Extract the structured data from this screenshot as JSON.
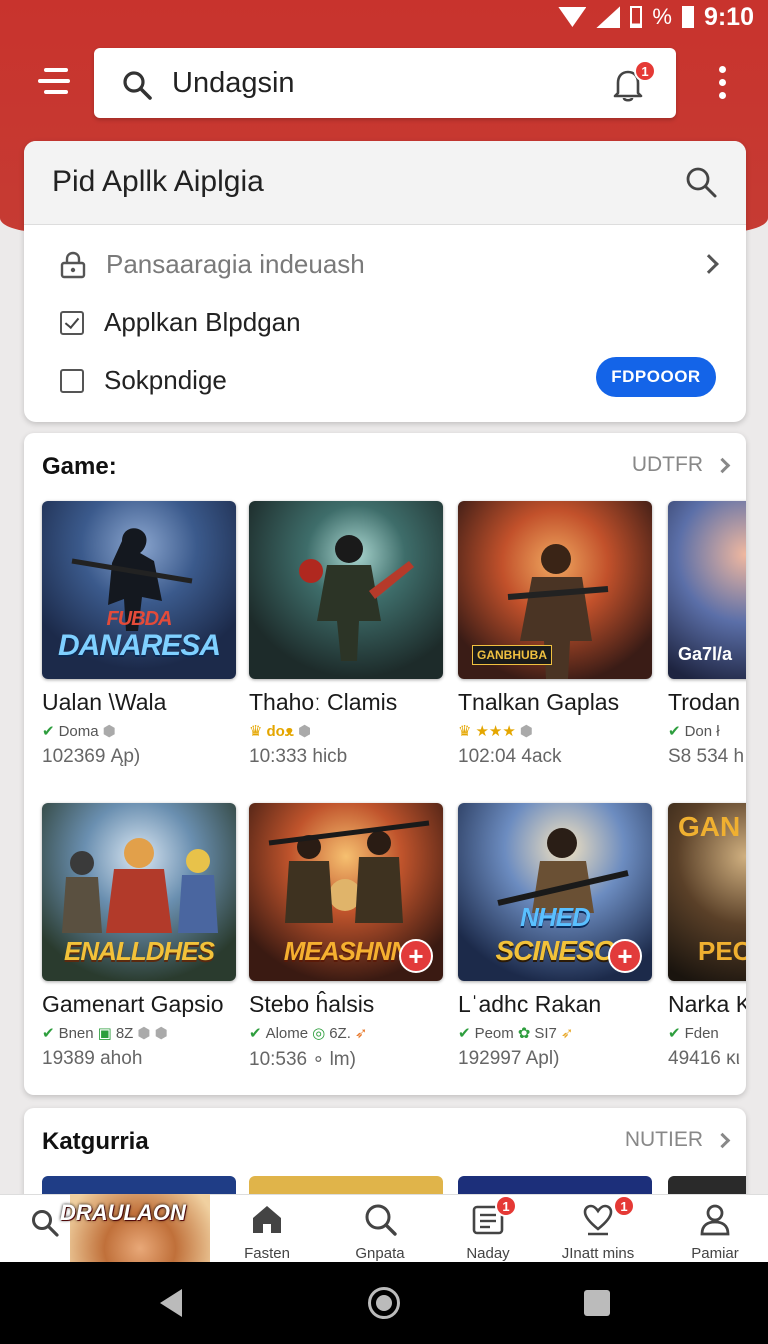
{
  "status_bar": {
    "time": "9:10"
  },
  "search": {
    "query": "Undagsin",
    "notification_count": "1"
  },
  "filter_card": {
    "title": "Pid Apllk Aiplgia",
    "rows": [
      {
        "label": "Pansaaragia indeuash"
      },
      {
        "label": "Applkan Blpdgan",
        "checked": true
      },
      {
        "label": "Sokpndige",
        "checked": false
      }
    ],
    "action_label": "FDPOOOR"
  },
  "games": {
    "title": "Game:",
    "more_label": "UDTFR",
    "tiles": [
      {
        "name": "Ualan \\Wala",
        "meta": "Doma",
        "size": "102369 Ąp)",
        "logo": "DANARESA",
        "logo_top": "FUBDA"
      },
      {
        "name": "Thahoː Clamis",
        "meta": "doᴥ",
        "size": "10:333 hicb"
      },
      {
        "name": "Tnalkan Gaplas",
        "meta": "★★★",
        "size": "102:04 4ack",
        "logo": "GANBHUBA"
      },
      {
        "name": "Trodan",
        "meta": "Don ł",
        "size": "S8 534 h",
        "logo": "Ga7l/a"
      },
      {
        "name": "Gamenart Gapsio",
        "meta": "Bnen",
        "meta2": "8Z",
        "size": "19389 ahoh",
        "logo": "ENALLDHES"
      },
      {
        "name": "Stebo ĥalsis",
        "meta": "Alome",
        "meta2": "6Z.",
        "size": "10:536 ∘ lm)",
        "logo": "MEASHNN"
      },
      {
        "name": "Lˈadhc Rakan",
        "meta": "Peom",
        "meta2": "SI7",
        "size": "192997 Apl)",
        "logo": "SCINESO",
        "logo_top": "NHED"
      },
      {
        "name": "Narka K",
        "meta": "Fden",
        "size": "49416 κι",
        "logo": "PEC",
        "logo_top": "GAN"
      }
    ]
  },
  "categories": {
    "title": "Katgurria",
    "more_label": "NUTIER"
  },
  "promo": {
    "text": "DRAULAON"
  },
  "bottom_nav": [
    {
      "label": "Fasten"
    },
    {
      "label": "Gnpata"
    },
    {
      "label": "Naday",
      "badge": "1"
    },
    {
      "label": "JInatt mins",
      "badge": "1"
    },
    {
      "label": "Pamiar"
    }
  ],
  "colors": {
    "brand_red": "#c8332d",
    "accent_blue": "#1464e8",
    "badge_red": "#e53935"
  }
}
